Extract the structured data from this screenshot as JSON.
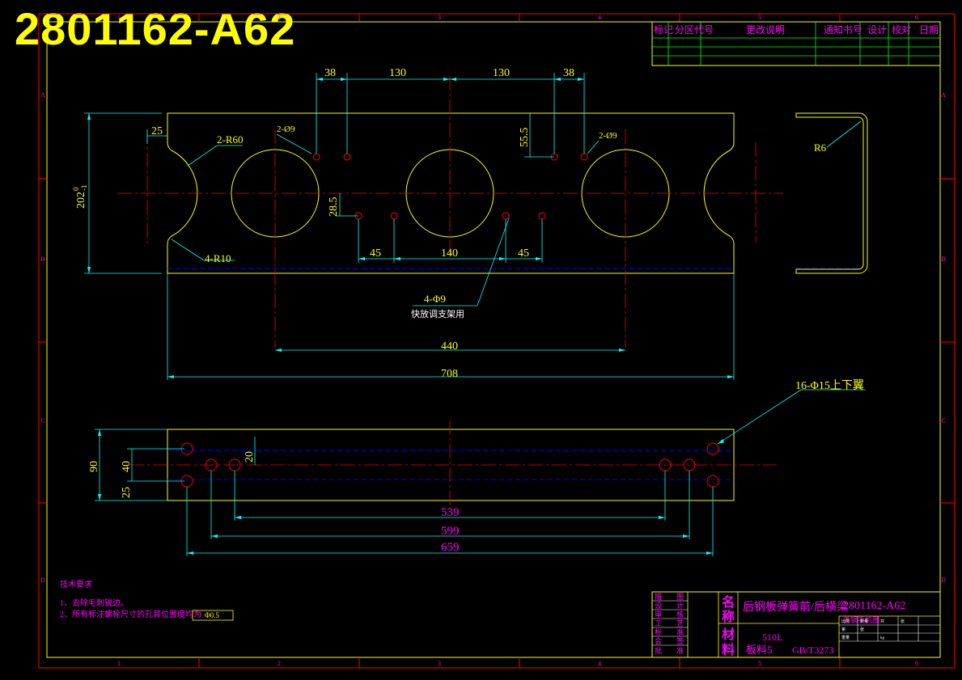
{
  "drawing_number": "2801162-A62",
  "colors": {
    "background": "#000000",
    "frame": "#ff0000",
    "outline": "#ffff00",
    "dimension": "#00ffff",
    "centerline": "#ff0000",
    "annotation": "#ff00ff",
    "note": "#00ff00"
  },
  "frame_ticks": {
    "columns": [
      "1",
      "2",
      "3",
      "4",
      "5",
      "6"
    ],
    "rows": [
      "A",
      "B",
      "C",
      "D"
    ]
  },
  "revision_table": {
    "headers": [
      "标记",
      "分区",
      "代号",
      "更改说明",
      "通知书号",
      "设计",
      "校对",
      "日期"
    ]
  },
  "top_view": {
    "dims": {
      "d38_left": "38",
      "d130_left": "130",
      "d130_right": "130",
      "d38_right": "38",
      "d25": "25",
      "d55_5": "55.5",
      "d28_5": "28.5",
      "d202": "202",
      "d202_tol_upper": "0",
      "d202_tol_lower": "-1",
      "d45_left": "45",
      "d140": "140",
      "d45_right": "45",
      "d440": "440",
      "d708": "708"
    },
    "callouts": {
      "r60": "2-R60",
      "hole_left": "2-Ø9",
      "hole_right": "2-Ø9",
      "r10": "4-R10",
      "holes_4": "4-Φ9",
      "holes_4_note": "快放调支架用"
    }
  },
  "side_view": {
    "callout_r6": "R6"
  },
  "bottom_view": {
    "dims": {
      "d90": "90",
      "d40": "40",
      "d25": "25",
      "d20": "20",
      "d539": "539",
      "d599": "599",
      "d659": "659"
    },
    "callout_holes": "16-Φ15上下翼"
  },
  "tech_notes": {
    "title": "技术要求",
    "line1": "1、去除毛刺锐边。",
    "line2": "2、所有标注螺栓尺寸的孔其位置度均为",
    "tolerance_value": "Φ0.5"
  },
  "title_block": {
    "part_name": "后钢板弹簧前/后横梁",
    "part_number": "2801162-A62",
    "project": "首钢手机图",
    "name_label": "名称",
    "material_label": "材料",
    "name_chars": [
      "名",
      "称"
    ],
    "material_chars": [
      "材",
      "料"
    ],
    "material_grade": "510L",
    "material_spec": "板料5",
    "standard": "GB/T3273",
    "left_rows": [
      [
        "描",
        "图"
      ],
      [
        "设",
        "计"
      ],
      [
        "审",
        "核"
      ],
      [
        "工",
        "艺"
      ],
      [
        "标",
        "准"
      ],
      [
        "会",
        "签"
      ],
      [
        "批",
        "准"
      ]
    ],
    "grid_labels": [
      "比例",
      "数量",
      "共",
      "张",
      "第",
      "张",
      "重量",
      "kg"
    ]
  }
}
